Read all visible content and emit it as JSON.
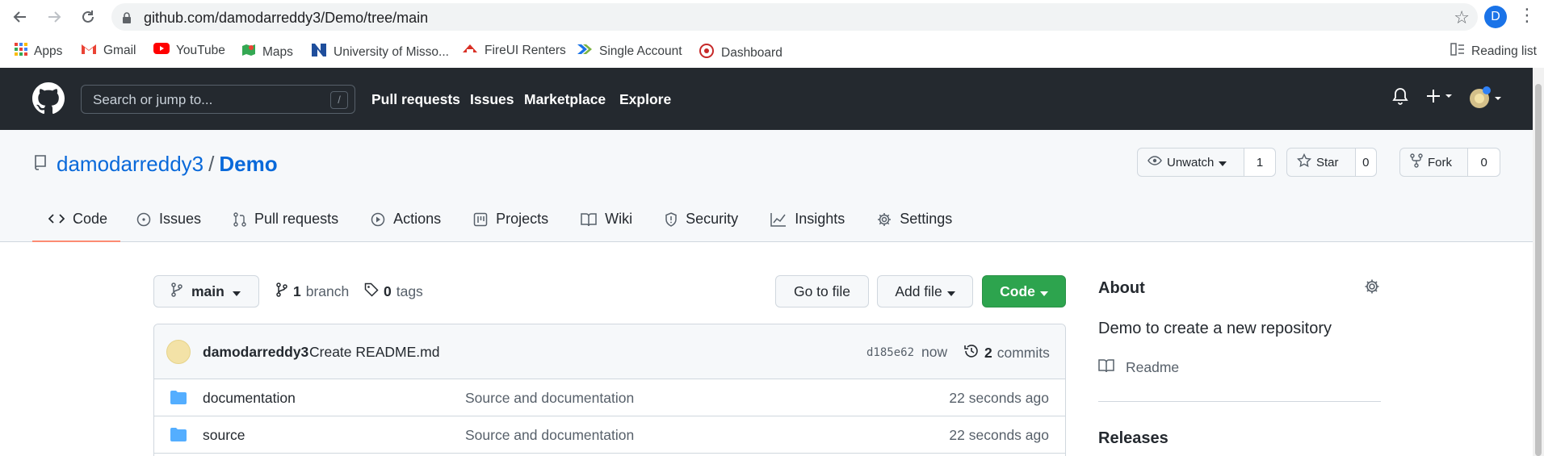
{
  "browser": {
    "url": "github.com/damodarreddy3/Demo/tree/main",
    "profile_initial": "D",
    "bookmarks": [
      {
        "label": "Apps",
        "icon": "apps-grid-icon"
      },
      {
        "label": "Gmail",
        "icon": "gmail-icon"
      },
      {
        "label": "YouTube",
        "icon": "youtube-icon"
      },
      {
        "label": "Maps",
        "icon": "maps-icon"
      },
      {
        "label": "University of Misso...",
        "icon": "university-icon"
      },
      {
        "label": "FireUI Renters",
        "icon": "fireui-icon"
      },
      {
        "label": "Single Account",
        "icon": "single-account-icon"
      },
      {
        "label": "Dashboard",
        "icon": "dashboard-icon"
      }
    ],
    "reading_list": "Reading list"
  },
  "github": {
    "search_placeholder": "Search or jump to...",
    "search_shortcut": "/",
    "nav": [
      "Pull requests",
      "Issues",
      "Marketplace",
      "Explore"
    ]
  },
  "repo": {
    "owner": "damodarreddy3",
    "separator": "/",
    "name": "Demo",
    "unwatch_label": "Unwatch",
    "watch_count": "1",
    "star_label": "Star",
    "star_count": "0",
    "fork_label": "Fork",
    "fork_count": "0",
    "tabs": [
      "Code",
      "Issues",
      "Pull requests",
      "Actions",
      "Projects",
      "Wiki",
      "Security",
      "Insights",
      "Settings"
    ]
  },
  "toolbar": {
    "branch": "main",
    "branch_count": "1",
    "branch_word": "branch",
    "tag_count": "0",
    "tag_word": "tags",
    "go_to_file": "Go to file",
    "add_file": "Add file",
    "code": "Code"
  },
  "commit": {
    "author": "damodarreddy3",
    "message": "Create README.md",
    "sha": "d185e62",
    "time": "now",
    "count": "2",
    "count_word": "commits"
  },
  "files": [
    {
      "name": "documentation",
      "message": "Source and documentation",
      "time": "22 seconds ago"
    },
    {
      "name": "source",
      "message": "Source and documentation",
      "time": "22 seconds ago"
    }
  ],
  "sidebar": {
    "about_title": "About",
    "description": "Demo to create a new repository",
    "readme": "Readme",
    "releases": "Releases"
  },
  "colors": {
    "header_bg": "#24292f",
    "link_blue": "#0969da",
    "code_green": "#2da44e",
    "tab_underline": "#fd8c73",
    "folder_blue": "#54aeff"
  }
}
